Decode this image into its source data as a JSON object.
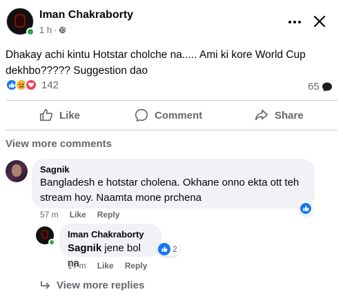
{
  "post": {
    "author": "Iman Chakraborty",
    "time": "1 h",
    "separator": "·",
    "text": "Dhakay achi kintu Hotstar cholche na..... Ami ki kore World Cup dekhbo????? Suggestion dao",
    "reaction_count": "142",
    "comment_count": "65"
  },
  "actions": {
    "like": "Like",
    "comment": "Comment",
    "share": "Share"
  },
  "comments_section": {
    "view_more_comments": "View more comments",
    "view_more_replies": "View more replies"
  },
  "comments": [
    {
      "author": "Sagnik",
      "text": "Bangladesh e hotstar cholena. Okhane onno ekta ott teh stream hoy. Naamta mone prchena",
      "time": "57 m",
      "like_label": "Like",
      "reply_label": "Reply"
    }
  ],
  "reply": {
    "author": "Iman Chakraborty",
    "mention": "Sagnik",
    "text": " jene bol na",
    "reaction_count": "2",
    "time": "17 m",
    "like_label": "Like",
    "reply_label": "Reply"
  },
  "colors": {
    "brand_blue": "#1877f2",
    "online_green": "#31a24c",
    "muted_text": "#65676b",
    "bubble_bg": "#f0f2f5"
  }
}
